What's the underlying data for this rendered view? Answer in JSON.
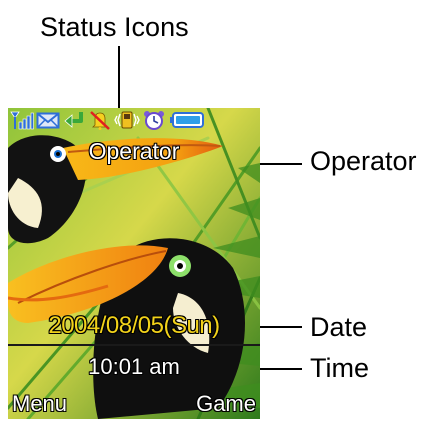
{
  "callouts": {
    "status_icons": "Status Icons",
    "operator": "Operator",
    "date": "Date",
    "time": "Time"
  },
  "screen": {
    "operator_name": "Operator",
    "date": "2004/08/05(Sun)",
    "time": "10:01 am",
    "softkey_left": "Menu",
    "softkey_right": "Game",
    "status_icons": [
      "signal-strength-icon",
      "message-envelope-icon",
      "call-divert-icon",
      "silent-mode-icon",
      "vibrate-icon",
      "alarm-clock-icon",
      "battery-icon"
    ],
    "colors": {
      "date_text": "#f2d21a",
      "status_icon_blue": "#2f6fd8",
      "wallpaper_green": "#2f7d1d"
    }
  }
}
